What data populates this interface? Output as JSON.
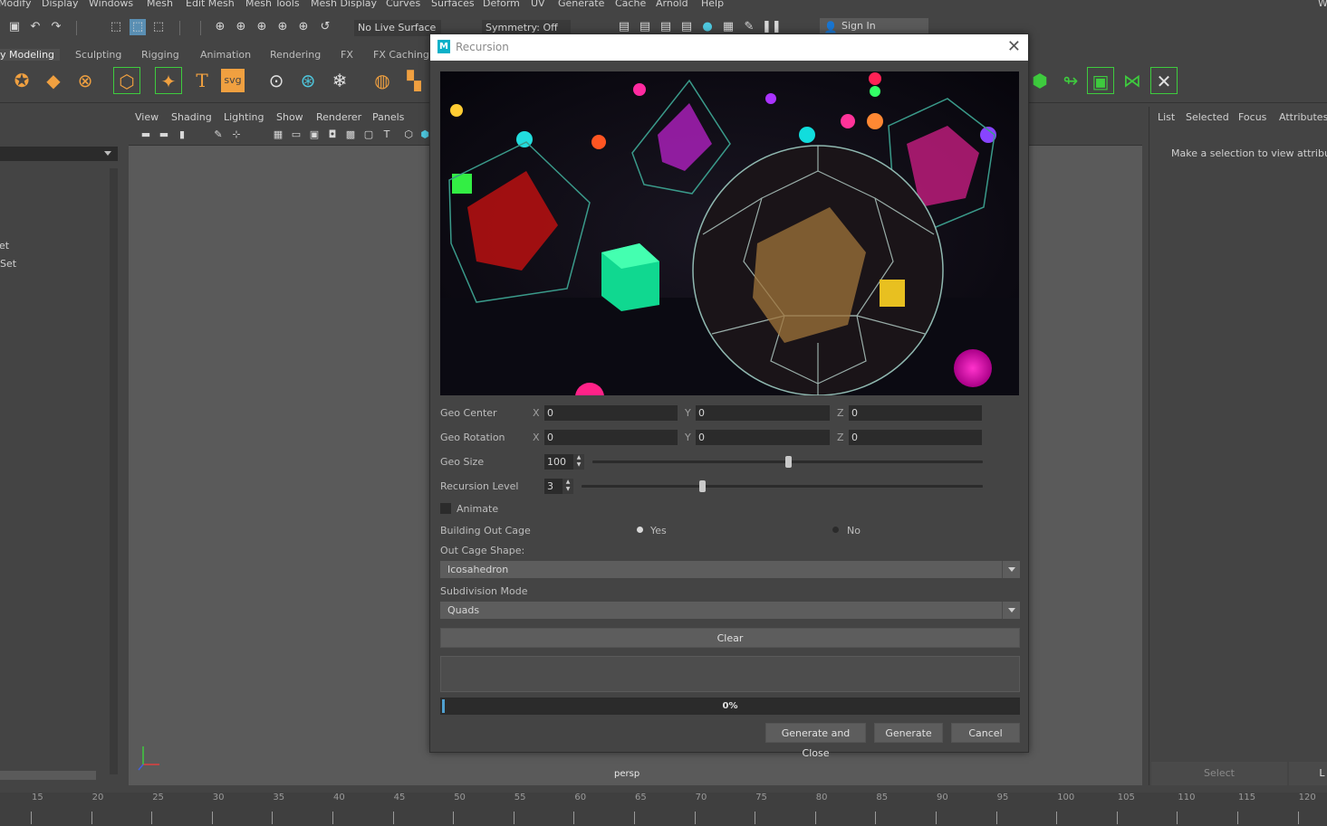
{
  "menubar": {
    "items": [
      "Modify",
      "Display",
      "Windows",
      "Mesh",
      "Edit Mesh",
      "Mesh Tools",
      "Mesh Display",
      "Curves",
      "Surfaces",
      "Deform",
      "UV",
      "Generate",
      "Cache",
      "Arnold",
      "Help"
    ],
    "workspace_fragment": "W"
  },
  "statusline": {
    "live_surface": "No Live Surface",
    "symmetry": "Symmetry: Off",
    "sign_in": "Sign In"
  },
  "shelf_tabs": [
    "y Modeling",
    "Sculpting",
    "Rigging",
    "Animation",
    "Rendering",
    "FX",
    "FX Caching"
  ],
  "left_panel": {
    "items": [
      "et",
      "Set"
    ]
  },
  "viewport": {
    "menu": [
      "View",
      "Shading",
      "Lighting",
      "Show",
      "Renderer",
      "Panels"
    ],
    "camera_label": "persp"
  },
  "right_panel": {
    "tabs": [
      "List",
      "Selected",
      "Focus",
      "Attributes"
    ],
    "message": "Make a selection to view attribute",
    "select_button": "Select",
    "load_button_fragment": "L"
  },
  "timeslider": {
    "ticks": [
      "15",
      "20",
      "25",
      "30",
      "35",
      "40",
      "45",
      "50",
      "55",
      "60",
      "65",
      "70",
      "75",
      "80",
      "85",
      "90",
      "95",
      "100",
      "105",
      "110",
      "115",
      "120"
    ]
  },
  "dialog": {
    "title": "Recursion",
    "geo_center": {
      "label": "Geo Center",
      "x": "0",
      "y": "0",
      "z": "0"
    },
    "geo_rotation": {
      "label": "Geo Rotation",
      "x": "0",
      "y": "0",
      "z": "0"
    },
    "axis_labels": {
      "x": "X",
      "y": "Y",
      "z": "Z"
    },
    "geo_size": {
      "label": "Geo Size",
      "value": "100",
      "slider_fraction": 0.5
    },
    "recursion_level": {
      "label": "Recursion Level",
      "value": "3",
      "slider_fraction": 0.3
    },
    "animate": {
      "label": "Animate",
      "checked": false
    },
    "building_out_cage": {
      "label": "Building Out Cage",
      "yes": "Yes",
      "no": "No",
      "selected": "Yes"
    },
    "out_cage_shape": {
      "label": "Out Cage Shape:",
      "value": "Icosahedron"
    },
    "subdivision_mode": {
      "label": "Subdivision Mode",
      "value": "Quads"
    },
    "clear_button": "Clear",
    "log_text": "",
    "progress": {
      "value": 0,
      "label": "0%"
    },
    "buttons": {
      "generate_close": "Generate and Close",
      "generate": "Generate",
      "cancel": "Cancel"
    }
  },
  "colors": {
    "maya_bg": "#444444",
    "viewport_bg": "#5a5a5a",
    "field_dark": "#2b2b2b",
    "accent_cyan": "#0ab0c8",
    "highlight_green": "#3ecb3e"
  }
}
